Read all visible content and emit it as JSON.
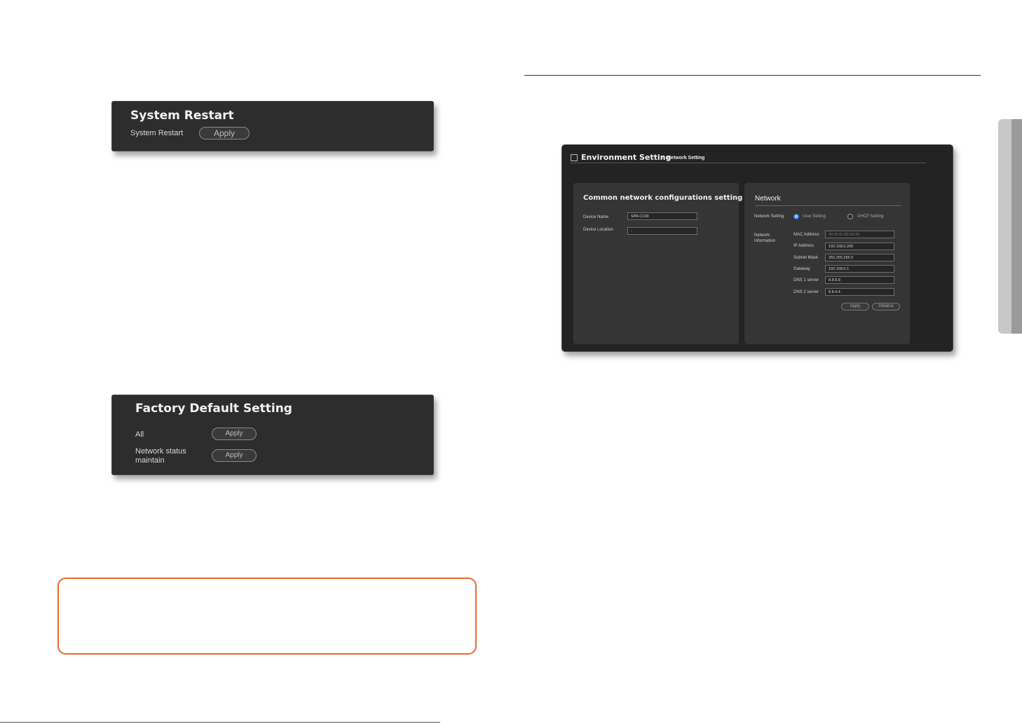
{
  "system_restart": {
    "title": "System Restart",
    "row_label": "System Restart",
    "apply_label": "Apply"
  },
  "factory_default": {
    "title": "Factory Default Setting",
    "rows": [
      {
        "label": "All",
        "apply_label": "Apply"
      },
      {
        "label_line1": "Network status",
        "label_line2": "maintain",
        "apply_label": "Apply"
      }
    ]
  },
  "env_setting": {
    "title": "Environment Setting",
    "breadcrumb_separator": ">",
    "breadcrumb": "Network Setting",
    "common": {
      "title": "Common network configurations setting",
      "device_name_label": "Device Name",
      "device_name_value": "SPA-C100",
      "device_location_label": "Device Location",
      "device_location_value": "-"
    },
    "network": {
      "title": "Network",
      "setting_label": "Network Setting",
      "user_setting": "User Setting",
      "dhcp_setting": "DHCP Setting",
      "info_label_line1": "Network",
      "info_label_line2": "Information",
      "mac_label": "MAC Address",
      "mac_value": "00:16:6c:69:3d:2b",
      "ip_label": "IP Address",
      "ip_value": "192.168.0.205",
      "subnet_label": "Subnet Mask",
      "subnet_value": "255.255.255.0",
      "gateway_label": "Gateway",
      "gateway_value": "192.168.0.1",
      "dns1_label": "DNS 1 server",
      "dns1_value": "8.8.8.8",
      "dns2_label": "DNS 2 server",
      "dns2_value": "8.8.4.4",
      "apply_label": "Apply",
      "initialize_label": "Initialize"
    }
  },
  "colors": {
    "accent_radio": "#3a7bd5",
    "note_border": "#e8692a",
    "side_tab": "#c8c8c8"
  }
}
